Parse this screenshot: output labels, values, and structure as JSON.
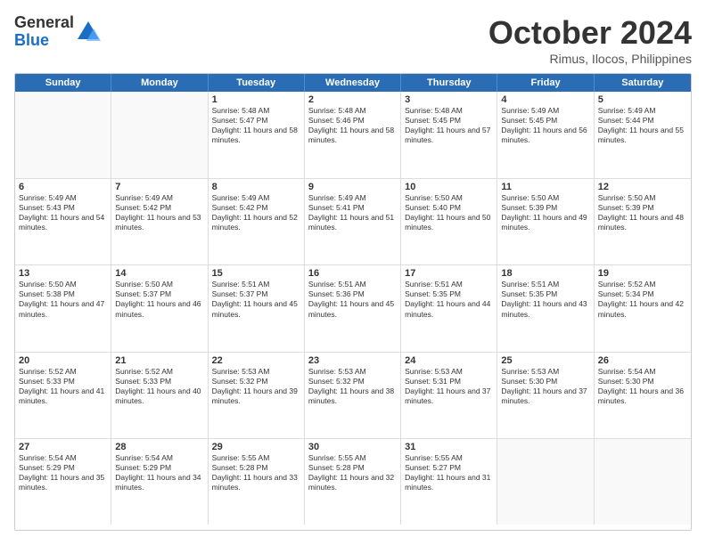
{
  "logo": {
    "general": "General",
    "blue": "Blue"
  },
  "title": "October 2024",
  "location": "Rimus, Ilocos, Philippines",
  "days": [
    "Sunday",
    "Monday",
    "Tuesday",
    "Wednesday",
    "Thursday",
    "Friday",
    "Saturday"
  ],
  "weeks": [
    [
      {
        "day": "",
        "sunrise": "",
        "sunset": "",
        "daylight": ""
      },
      {
        "day": "",
        "sunrise": "",
        "sunset": "",
        "daylight": ""
      },
      {
        "day": "1",
        "sunrise": "Sunrise: 5:48 AM",
        "sunset": "Sunset: 5:47 PM",
        "daylight": "Daylight: 11 hours and 58 minutes."
      },
      {
        "day": "2",
        "sunrise": "Sunrise: 5:48 AM",
        "sunset": "Sunset: 5:46 PM",
        "daylight": "Daylight: 11 hours and 58 minutes."
      },
      {
        "day": "3",
        "sunrise": "Sunrise: 5:48 AM",
        "sunset": "Sunset: 5:45 PM",
        "daylight": "Daylight: 11 hours and 57 minutes."
      },
      {
        "day": "4",
        "sunrise": "Sunrise: 5:49 AM",
        "sunset": "Sunset: 5:45 PM",
        "daylight": "Daylight: 11 hours and 56 minutes."
      },
      {
        "day": "5",
        "sunrise": "Sunrise: 5:49 AM",
        "sunset": "Sunset: 5:44 PM",
        "daylight": "Daylight: 11 hours and 55 minutes."
      }
    ],
    [
      {
        "day": "6",
        "sunrise": "Sunrise: 5:49 AM",
        "sunset": "Sunset: 5:43 PM",
        "daylight": "Daylight: 11 hours and 54 minutes."
      },
      {
        "day": "7",
        "sunrise": "Sunrise: 5:49 AM",
        "sunset": "Sunset: 5:42 PM",
        "daylight": "Daylight: 11 hours and 53 minutes."
      },
      {
        "day": "8",
        "sunrise": "Sunrise: 5:49 AM",
        "sunset": "Sunset: 5:42 PM",
        "daylight": "Daylight: 11 hours and 52 minutes."
      },
      {
        "day": "9",
        "sunrise": "Sunrise: 5:49 AM",
        "sunset": "Sunset: 5:41 PM",
        "daylight": "Daylight: 11 hours and 51 minutes."
      },
      {
        "day": "10",
        "sunrise": "Sunrise: 5:50 AM",
        "sunset": "Sunset: 5:40 PM",
        "daylight": "Daylight: 11 hours and 50 minutes."
      },
      {
        "day": "11",
        "sunrise": "Sunrise: 5:50 AM",
        "sunset": "Sunset: 5:39 PM",
        "daylight": "Daylight: 11 hours and 49 minutes."
      },
      {
        "day": "12",
        "sunrise": "Sunrise: 5:50 AM",
        "sunset": "Sunset: 5:39 PM",
        "daylight": "Daylight: 11 hours and 48 minutes."
      }
    ],
    [
      {
        "day": "13",
        "sunrise": "Sunrise: 5:50 AM",
        "sunset": "Sunset: 5:38 PM",
        "daylight": "Daylight: 11 hours and 47 minutes."
      },
      {
        "day": "14",
        "sunrise": "Sunrise: 5:50 AM",
        "sunset": "Sunset: 5:37 PM",
        "daylight": "Daylight: 11 hours and 46 minutes."
      },
      {
        "day": "15",
        "sunrise": "Sunrise: 5:51 AM",
        "sunset": "Sunset: 5:37 PM",
        "daylight": "Daylight: 11 hours and 45 minutes."
      },
      {
        "day": "16",
        "sunrise": "Sunrise: 5:51 AM",
        "sunset": "Sunset: 5:36 PM",
        "daylight": "Daylight: 11 hours and 45 minutes."
      },
      {
        "day": "17",
        "sunrise": "Sunrise: 5:51 AM",
        "sunset": "Sunset: 5:35 PM",
        "daylight": "Daylight: 11 hours and 44 minutes."
      },
      {
        "day": "18",
        "sunrise": "Sunrise: 5:51 AM",
        "sunset": "Sunset: 5:35 PM",
        "daylight": "Daylight: 11 hours and 43 minutes."
      },
      {
        "day": "19",
        "sunrise": "Sunrise: 5:52 AM",
        "sunset": "Sunset: 5:34 PM",
        "daylight": "Daylight: 11 hours and 42 minutes."
      }
    ],
    [
      {
        "day": "20",
        "sunrise": "Sunrise: 5:52 AM",
        "sunset": "Sunset: 5:33 PM",
        "daylight": "Daylight: 11 hours and 41 minutes."
      },
      {
        "day": "21",
        "sunrise": "Sunrise: 5:52 AM",
        "sunset": "Sunset: 5:33 PM",
        "daylight": "Daylight: 11 hours and 40 minutes."
      },
      {
        "day": "22",
        "sunrise": "Sunrise: 5:53 AM",
        "sunset": "Sunset: 5:32 PM",
        "daylight": "Daylight: 11 hours and 39 minutes."
      },
      {
        "day": "23",
        "sunrise": "Sunrise: 5:53 AM",
        "sunset": "Sunset: 5:32 PM",
        "daylight": "Daylight: 11 hours and 38 minutes."
      },
      {
        "day": "24",
        "sunrise": "Sunrise: 5:53 AM",
        "sunset": "Sunset: 5:31 PM",
        "daylight": "Daylight: 11 hours and 37 minutes."
      },
      {
        "day": "25",
        "sunrise": "Sunrise: 5:53 AM",
        "sunset": "Sunset: 5:30 PM",
        "daylight": "Daylight: 11 hours and 37 minutes."
      },
      {
        "day": "26",
        "sunrise": "Sunrise: 5:54 AM",
        "sunset": "Sunset: 5:30 PM",
        "daylight": "Daylight: 11 hours and 36 minutes."
      }
    ],
    [
      {
        "day": "27",
        "sunrise": "Sunrise: 5:54 AM",
        "sunset": "Sunset: 5:29 PM",
        "daylight": "Daylight: 11 hours and 35 minutes."
      },
      {
        "day": "28",
        "sunrise": "Sunrise: 5:54 AM",
        "sunset": "Sunset: 5:29 PM",
        "daylight": "Daylight: 11 hours and 34 minutes."
      },
      {
        "day": "29",
        "sunrise": "Sunrise: 5:55 AM",
        "sunset": "Sunset: 5:28 PM",
        "daylight": "Daylight: 11 hours and 33 minutes."
      },
      {
        "day": "30",
        "sunrise": "Sunrise: 5:55 AM",
        "sunset": "Sunset: 5:28 PM",
        "daylight": "Daylight: 11 hours and 32 minutes."
      },
      {
        "day": "31",
        "sunrise": "Sunrise: 5:55 AM",
        "sunset": "Sunset: 5:27 PM",
        "daylight": "Daylight: 11 hours and 31 minutes."
      },
      {
        "day": "",
        "sunrise": "",
        "sunset": "",
        "daylight": ""
      },
      {
        "day": "",
        "sunrise": "",
        "sunset": "",
        "daylight": ""
      }
    ]
  ]
}
